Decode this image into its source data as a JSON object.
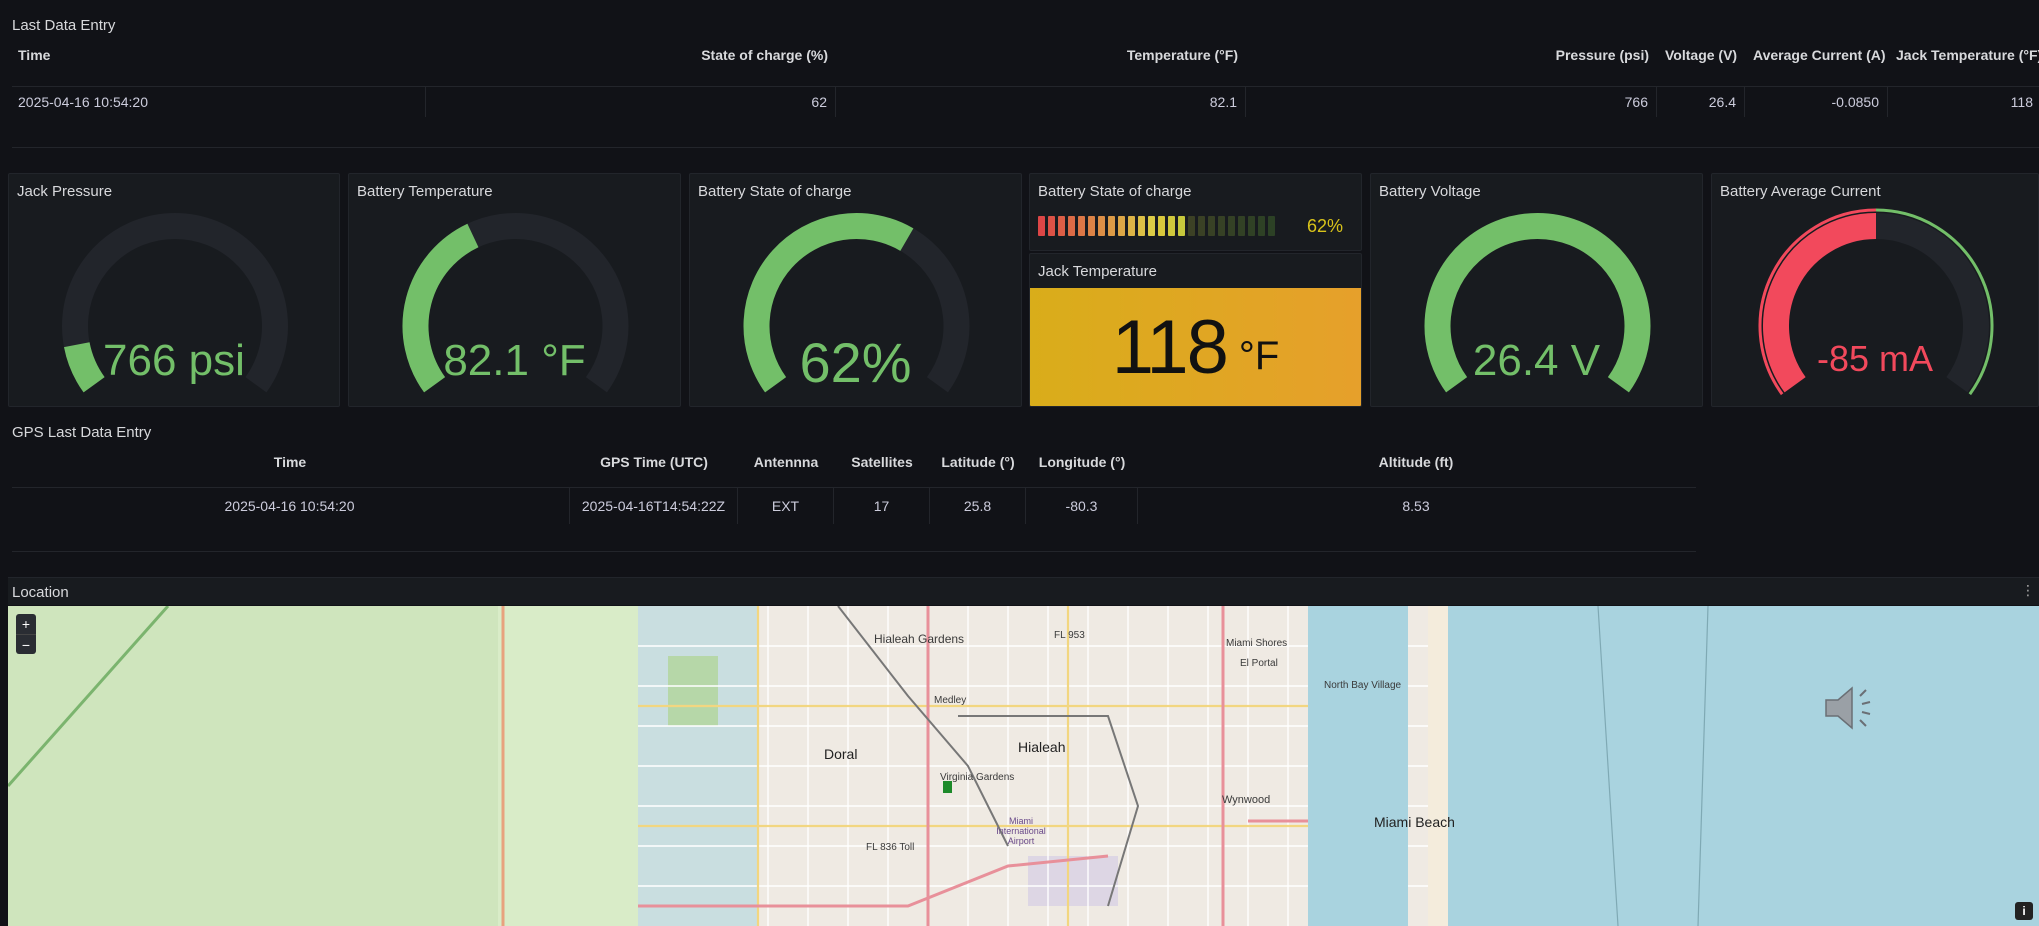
{
  "last_entry": {
    "title": "Last Data Entry",
    "headers": [
      "Time",
      "State of charge (%)",
      "Temperature (°F)",
      "Pressure (psi)",
      "Voltage (V)",
      "Average Current (A)",
      "Jack Temperature (°F)"
    ],
    "row": [
      "2025-04-16 10:54:20",
      "62",
      "82.1",
      "766",
      "26.4",
      "-0.0850",
      "118"
    ]
  },
  "gauges": {
    "jack_pressure": {
      "title": "Jack Pressure",
      "value": "766 psi",
      "level": 0.1,
      "color": "#73bf69"
    },
    "battery_temperature": {
      "title": "Battery Temperature",
      "value": "82.1 °F",
      "level": 0.4,
      "color": "#73bf69"
    },
    "battery_soc": {
      "title": "Battery State of charge",
      "value": "62%",
      "level": 0.62,
      "color": "#73bf69"
    },
    "battery_voltage": {
      "title": "Battery Voltage",
      "value": "26.4 V",
      "level": 1.0,
      "color": "#73bf69"
    },
    "battery_current": {
      "title": "Battery Average Current",
      "value": "-85 mA",
      "level": 0.5,
      "color": "#f2495c"
    }
  },
  "bar_gauge": {
    "title": "Battery State of charge",
    "value": "62%",
    "level": 0.62
  },
  "jack_temp_stat": {
    "title": "Jack Temperature",
    "value": "118",
    "unit": "°F"
  },
  "gps": {
    "title": "GPS Last Data Entry",
    "headers": [
      "Time",
      "GPS Time (UTC)",
      "Antennna",
      "Satellites",
      "Latitude (°)",
      "Longitude (°)",
      "Altitude (ft)"
    ],
    "row": [
      "2025-04-16 10:54:20",
      "2025-04-16T14:54:22Z",
      "EXT",
      "17",
      "25.8",
      "-80.3",
      "8.53"
    ]
  },
  "location": {
    "title": "Location",
    "zoom_in": "+",
    "zoom_out": "−",
    "info": "i",
    "labels": {
      "hialeah_gardens": "Hialeah Gardens",
      "fl953": "FL 953",
      "miami_shores": "Miami Shores",
      "el_portal": "El Portal",
      "north_bay_village": "North Bay Village",
      "medley": "Medley",
      "hialeah": "Hialeah",
      "doral": "Doral",
      "virginia_gardens": "Virginia Gardens",
      "wynwood": "Wynwood",
      "miami_beach": "Miami Beach",
      "miami_intl": "Miami International Airport",
      "fl836": "FL 836 Toll"
    }
  },
  "colors": {
    "green": "#73bf69",
    "red": "#f2495c",
    "track": "#22252b",
    "bg": "#111217"
  }
}
